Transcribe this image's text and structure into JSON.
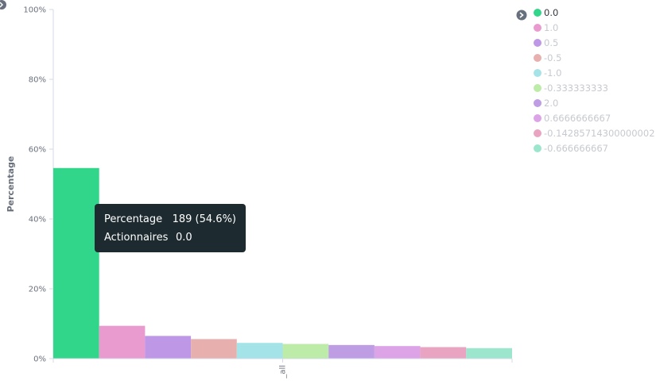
{
  "chart_data": {
    "type": "bar",
    "ylabel": "Percentage",
    "xlabel": "",
    "categories": [
      "_all"
    ],
    "ylim": [
      0,
      100
    ],
    "yticks": [
      "0%",
      "20%",
      "40%",
      "60%",
      "80%",
      "100%"
    ],
    "ytick_values": [
      0,
      20,
      40,
      60,
      80,
      100
    ],
    "series": [
      {
        "name": "0.0",
        "values": [
          54.6
        ],
        "color": "#32d68b"
      },
      {
        "name": "1.0",
        "values": [
          9.4
        ],
        "color": "#e99bd0"
      },
      {
        "name": "0.5",
        "values": [
          6.5
        ],
        "color": "#bf97e7"
      },
      {
        "name": "-0.5",
        "values": [
          5.6
        ],
        "color": "#e7b0ae"
      },
      {
        "name": "-1.0",
        "values": [
          4.5
        ],
        "color": "#a4e3e7"
      },
      {
        "name": "-0.333333333",
        "values": [
          4.2
        ],
        "color": "#bdeba8"
      },
      {
        "name": "2.0",
        "values": [
          3.9
        ],
        "color": "#bf9de5"
      },
      {
        "name": "0.6666666667",
        "values": [
          3.6
        ],
        "color": "#dca3e6"
      },
      {
        "name": "-0.14285714300000002",
        "values": [
          3.3
        ],
        "color": "#e9a4c2"
      },
      {
        "name": "-0.666666667",
        "values": [
          3.0
        ],
        "color": "#9be6cd"
      }
    ],
    "legend": {
      "placement": "top-right",
      "active": "0.0"
    },
    "grid": false
  },
  "tooltip": {
    "row1_key": "Percentage",
    "row1_value": "189 (54.6%)",
    "row2_key": "Actionnaires",
    "row2_value": "0.0"
  },
  "colors": {
    "legend_inactive_text": "#c6c9cf",
    "legend_active_text": "#343741",
    "axis": "#d3dae6"
  }
}
